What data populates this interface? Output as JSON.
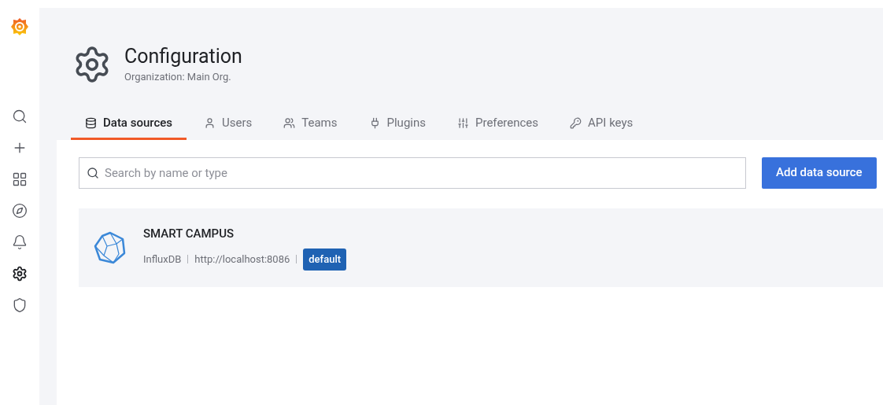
{
  "sidebar": {
    "items": [
      {
        "kind": "search",
        "selected": false
      },
      {
        "kind": "plus",
        "selected": false
      },
      {
        "kind": "grid",
        "selected": false
      },
      {
        "kind": "compass",
        "selected": false
      },
      {
        "kind": "bell",
        "selected": false
      },
      {
        "kind": "gear",
        "selected": true
      },
      {
        "kind": "shield",
        "selected": false
      }
    ]
  },
  "header": {
    "title": "Configuration",
    "subtitle": "Organization: Main Org."
  },
  "tabs": [
    {
      "label": "Data sources",
      "kind": "database",
      "selected": true
    },
    {
      "label": "Users",
      "kind": "user",
      "selected": false
    },
    {
      "label": "Teams",
      "kind": "users",
      "selected": false
    },
    {
      "label": "Plugins",
      "kind": "plug",
      "selected": false
    },
    {
      "label": "Preferences",
      "kind": "sliders",
      "selected": false
    },
    {
      "label": "API keys",
      "kind": "key",
      "selected": false
    }
  ],
  "search": {
    "placeholder": "Search by name or type"
  },
  "add_button": "Add data source",
  "datasources": [
    {
      "name": "SMART CAMPUS",
      "type": "InfluxDB",
      "url": "http://localhost:8086",
      "default": true,
      "badge": "default"
    }
  ]
}
